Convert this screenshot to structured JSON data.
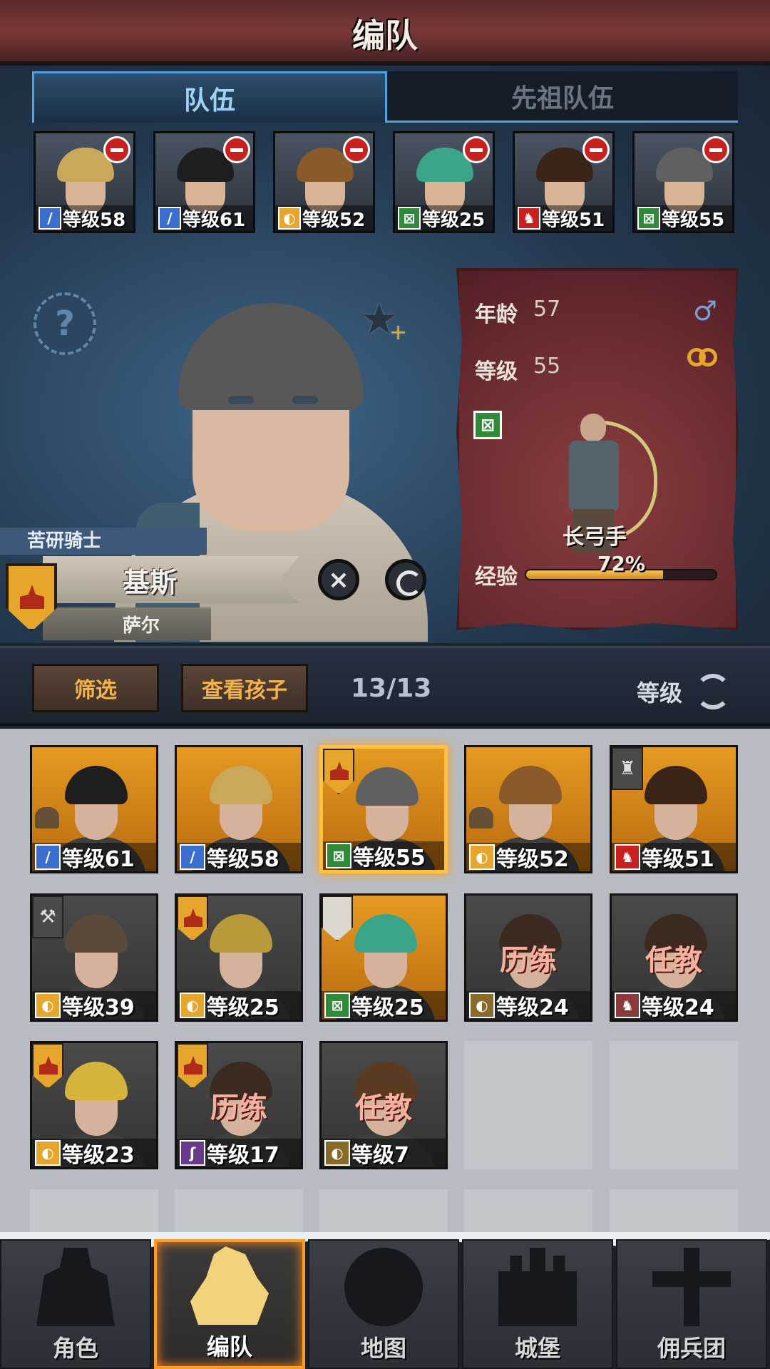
{
  "header": {
    "title": "编队"
  },
  "tabs": [
    {
      "label": "队伍",
      "active": true
    },
    {
      "label": "先祖队伍",
      "active": false
    }
  ],
  "team": [
    {
      "level": "等级58",
      "class_icon": "sword-icon",
      "class_color": "#3a6fd0",
      "hair": "#c9a85a"
    },
    {
      "level": "等级61",
      "class_icon": "sword-icon",
      "class_color": "#3a6fd0",
      "hair": "#1e1e1e"
    },
    {
      "level": "等级52",
      "class_icon": "shield-icon",
      "class_color": "#e6a52b",
      "hair": "#8a5a2a"
    },
    {
      "level": "等级25",
      "class_icon": "bow-icon",
      "class_color": "#2f8a3a",
      "hair": "#3aa588"
    },
    {
      "level": "等级51",
      "class_icon": "beast-icon",
      "class_color": "#c92020",
      "hair": "#3a2418"
    },
    {
      "level": "等级55",
      "class_icon": "bow-icon",
      "class_color": "#2f8a3a",
      "hair": "#606060"
    }
  ],
  "hero": {
    "title": "苦研骑士",
    "name": "基斯",
    "house": "萨尔",
    "age_label": "年龄",
    "age": "57",
    "level_label": "等级",
    "level": "55",
    "class_name": "长弓手",
    "exp_label": "经验",
    "exp_pct_text": "72%",
    "exp_fraction": 0.72
  },
  "filter": {
    "filter_label": "筛选",
    "children_label": "查看孩子",
    "count": "13/13",
    "sort_label": "等级"
  },
  "roster": [
    {
      "level": "等级61",
      "class_icon": "sword-icon",
      "class_color": "#3a6fd0",
      "hair": "#1e1e1e",
      "status": "",
      "crest": "",
      "helmet": true
    },
    {
      "level": "等级58",
      "class_icon": "sword-icon",
      "class_color": "#3a6fd0",
      "hair": "#c9a85a",
      "status": "",
      "crest": "",
      "helmet": false
    },
    {
      "level": "等级55",
      "class_icon": "bow-icon",
      "class_color": "#2f8a3a",
      "hair": "#606060",
      "status": "",
      "crest": "house-crest",
      "helmet": false,
      "selected": true
    },
    {
      "level": "等级52",
      "class_icon": "shield-icon",
      "class_color": "#e6a52b",
      "hair": "#8a5a2a",
      "status": "",
      "crest": "",
      "helmet": true
    },
    {
      "level": "等级51",
      "class_icon": "beast-icon",
      "class_color": "#c92020",
      "hair": "#3a2418",
      "status": "",
      "crest": "order-badge",
      "helmet": false
    },
    {
      "level": "等级39",
      "class_icon": "shield-icon",
      "class_color": "#e6a52b",
      "hair": "#5a4a3a",
      "status": "",
      "crest": "axe-badge",
      "helmet": false,
      "dim": true
    },
    {
      "level": "等级25",
      "class_icon": "shield-icon",
      "class_color": "#e6a52b",
      "hair": "#b89a3a",
      "status": "",
      "crest": "house-crest",
      "helmet": false,
      "dim": true
    },
    {
      "level": "等级25",
      "class_icon": "bow-icon",
      "class_color": "#2f8a3a",
      "hair": "#3aa588",
      "status": "",
      "crest": "white-banner",
      "helmet": false
    },
    {
      "level": "等级24",
      "class_icon": "shield-icon",
      "class_color": "#8a6a2a",
      "hair": "#3a2a20",
      "status": "历练",
      "crest": "",
      "helmet": false,
      "dim": true
    },
    {
      "level": "等级24",
      "class_icon": "beast-icon",
      "class_color": "#8a3a3a",
      "hair": "#3a2a20",
      "status": "任教",
      "crest": "",
      "helmet": false,
      "dim": true
    },
    {
      "level": "等级23",
      "class_icon": "shield-icon",
      "class_color": "#e6a52b",
      "hair": "#d4b43a",
      "status": "",
      "crest": "house-crest",
      "helmet": false,
      "dim": true
    },
    {
      "level": "等级17",
      "class_icon": "staff-icon",
      "class_color": "#6a3a8a",
      "hair": "#3a2a20",
      "status": "历练",
      "crest": "house-crest",
      "helmet": false,
      "dim": true
    },
    {
      "level": "等级7",
      "class_icon": "shield-icon",
      "class_color": "#8a6a2a",
      "hair": "#5a3a20",
      "status": "任教",
      "crest": "",
      "helmet": false,
      "dim": true
    }
  ],
  "nav": [
    {
      "label": "角色",
      "icon": "knight-icon",
      "active": false
    },
    {
      "label": "编队",
      "icon": "helmet-icon",
      "active": true
    },
    {
      "label": "地图",
      "icon": "compass-icon",
      "active": false
    },
    {
      "label": "城堡",
      "icon": "castle-icon",
      "active": false
    },
    {
      "label": "佣兵团",
      "icon": "banner-icon",
      "active": false
    }
  ]
}
